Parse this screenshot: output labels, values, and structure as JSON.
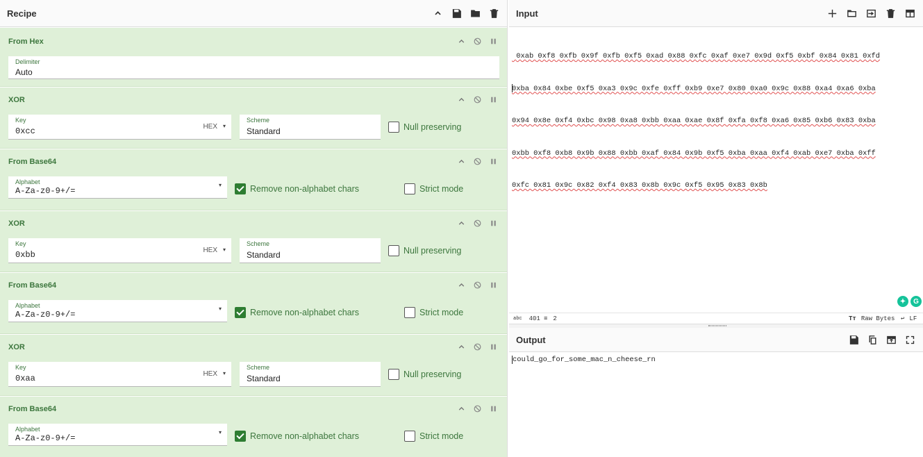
{
  "recipe": {
    "title": "Recipe",
    "operations": [
      {
        "name": "From Hex",
        "delimiter_label": "Delimiter",
        "delimiter_value": "Auto"
      },
      {
        "name": "XOR",
        "key_label": "Key",
        "key_value": "0xcc",
        "key_format": "HEX",
        "scheme_label": "Scheme",
        "scheme_value": "Standard",
        "null_label": "Null preserving",
        "null_checked": false
      },
      {
        "name": "From Base64",
        "alphabet_label": "Alphabet",
        "alphabet_value": "A-Za-z0-9+/=",
        "remove_label": "Remove non-alphabet chars",
        "remove_checked": true,
        "strict_label": "Strict mode",
        "strict_checked": false
      },
      {
        "name": "XOR",
        "key_label": "Key",
        "key_value": "0xbb",
        "key_format": "HEX",
        "scheme_label": "Scheme",
        "scheme_value": "Standard",
        "null_label": "Null preserving",
        "null_checked": false
      },
      {
        "name": "From Base64",
        "alphabet_label": "Alphabet",
        "alphabet_value": "A-Za-z0-9+/=",
        "remove_label": "Remove non-alphabet chars",
        "remove_checked": true,
        "strict_label": "Strict mode",
        "strict_checked": false
      },
      {
        "name": "XOR",
        "key_label": "Key",
        "key_value": "0xaa",
        "key_format": "HEX",
        "scheme_label": "Scheme",
        "scheme_value": "Standard",
        "null_label": "Null preserving",
        "null_checked": false
      },
      {
        "name": "From Base64",
        "alphabet_label": "Alphabet",
        "alphabet_value": "A-Za-z0-9+/=",
        "remove_label": "Remove non-alphabet chars",
        "remove_checked": true,
        "strict_label": "Strict mode",
        "strict_checked": false
      }
    ]
  },
  "input": {
    "title": "Input",
    "lines": [
      " 0xab 0xf8 0xfb 0x9f 0xfb 0xf5 0xad 0x88 0xfc 0xaf 0xe7 0x9d 0xf5 0xbf 0x84 0x81 0xfd",
      "0xba 0x84 0xbe 0xf5 0xa3 0x9c 0xfe 0xff 0xb9 0xe7 0x80 0xa0 0x9c 0x88 0xa4 0xa6 0xba",
      "0x94 0x8e 0xf4 0xbc 0x98 0xa8 0xbb 0xaa 0xae 0x8f 0xfa 0xf8 0xa6 0x85 0xb6 0x83 0xba",
      "0xbb 0xf8 0xb8 0x9b 0x88 0xbb 0xaf 0x84 0x9b 0xf5 0xba 0xaa 0xf4 0xab 0xe7 0xba 0xff",
      "0xfc 0x81 0x9c 0x82 0xf4 0x83 0x8b 0x9c 0xf5 0x95 0x83 0x8b"
    ],
    "status_length_label": "abc",
    "status_length": "401",
    "status_lines": "2",
    "status_encoding": "Raw Bytes",
    "status_eol": "LF"
  },
  "output": {
    "title": "Output",
    "text": "could_go_for_some_mac_n_cheese_rn"
  },
  "colors": {
    "op_bg": "#dff0d8",
    "op_text": "#3c763d",
    "check_on": "#2e7d32"
  }
}
